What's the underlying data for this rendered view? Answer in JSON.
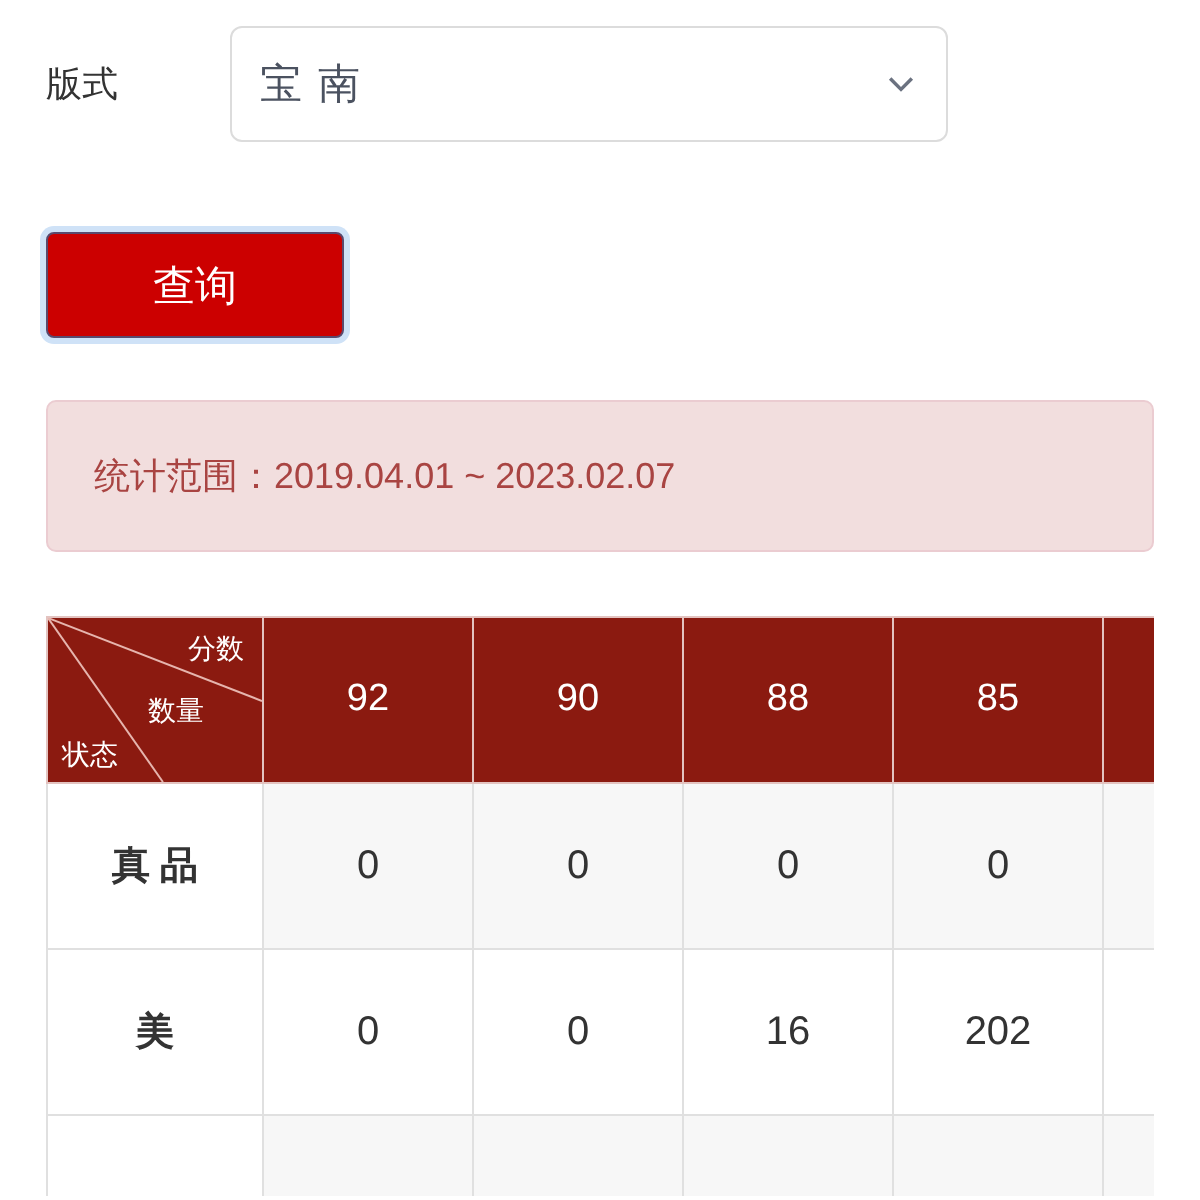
{
  "form": {
    "label": "版式",
    "select": {
      "value": "宝 南"
    }
  },
  "query_button": {
    "label": "查询",
    "focused": true
  },
  "alert": {
    "text": "统计范围：2019.04.01 ~ 2023.02.07"
  },
  "table": {
    "corner": {
      "top": "分数",
      "middle": "数量",
      "bottom": "状态"
    },
    "columns": [
      "92",
      "90",
      "88",
      "85"
    ],
    "more_columns": true,
    "more_rows": true,
    "rows": [
      {
        "label": "真 品",
        "values": [
          "0",
          "0",
          "0",
          "0"
        ]
      },
      {
        "label": "美",
        "values": [
          "0",
          "0",
          "16",
          "202"
        ]
      }
    ]
  }
}
